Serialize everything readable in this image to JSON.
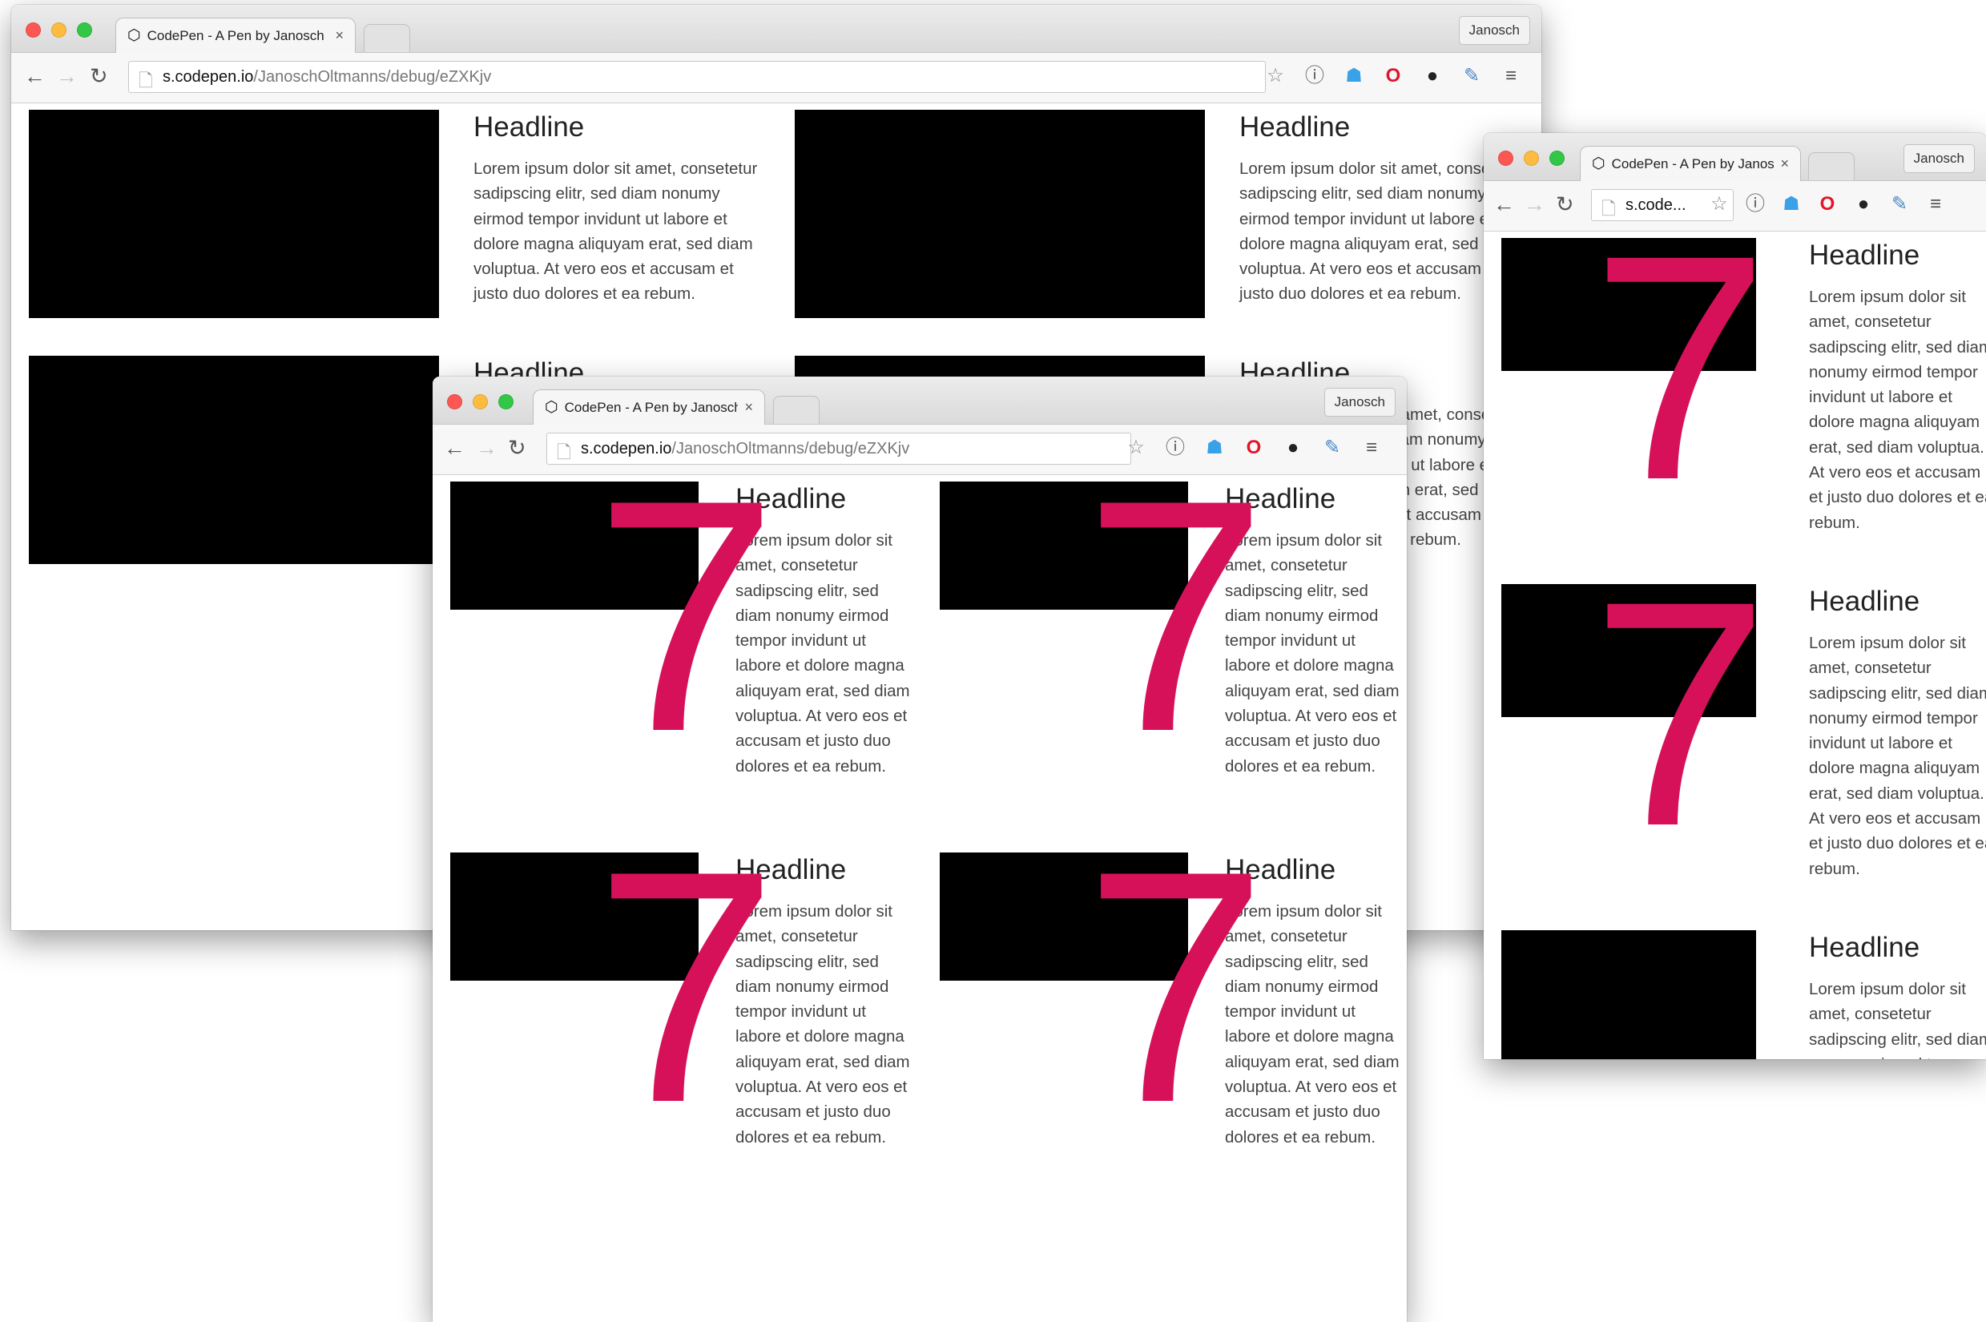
{
  "browser": {
    "tab_title": "CodePen - A Pen by Janosch Oltmanns",
    "tab_logo": "codepen-logo",
    "profile": "Janosch",
    "url_host": "s.codepen.io",
    "url_path": "/JanoschOltmanns/debug/eZXKjv",
    "url_short": "s.code...",
    "icons": [
      "back-arrow",
      "forward-arrow",
      "reload",
      "page",
      "bookmark-star",
      "info",
      "ghostery-ghost",
      "opera",
      "color-globe",
      "color-picker",
      "menu"
    ],
    "traffic_colors": [
      "#fc5753",
      "#fdbc40",
      "#33c748"
    ]
  },
  "card": {
    "headline": "Headline",
    "body": "Lorem ipsum dolor sit amet, consetetur sadipscing elitr, sed diam nonumy eirmod tempor invidunt ut labore et dolore magna aliquyam erat, sed diam voluptua. At vero eos et accusam et justo duo dolores et ea rebum."
  },
  "overlay": {
    "digit": "7",
    "color": "#d6115a"
  }
}
